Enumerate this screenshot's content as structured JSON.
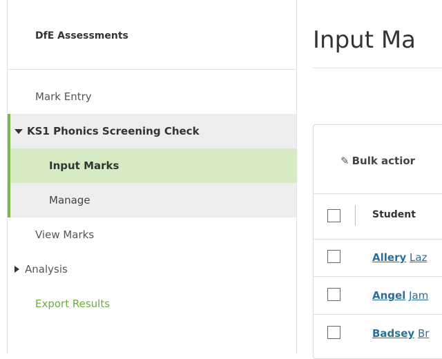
{
  "sidebar": {
    "title": "DfE Assessments",
    "items": {
      "mark_entry": "Mark Entry",
      "ks1": "KS1 Phonics Screening Check",
      "input_marks": "Input Marks",
      "manage": "Manage",
      "view_marks": "View Marks",
      "analysis": "Analysis",
      "export": "Export Results"
    }
  },
  "main": {
    "title": "Input Ma",
    "bulk_label": "Bulk actior",
    "table": {
      "student_header": "Student",
      "rows": [
        {
          "surname": "Allery",
          "forename": "Laz"
        },
        {
          "surname": "Angel",
          "forename": "Jam"
        },
        {
          "surname": "Badsey",
          "forename": "Br"
        }
      ]
    }
  },
  "colors": {
    "accent_green": "#7ab648",
    "active_bg": "#d6ebc4",
    "link": "#2a6f97",
    "export_green": "#6cae3a"
  },
  "icons": {
    "caret_down": "caret-down-icon",
    "caret_right": "caret-right-icon",
    "pencil": "pencil-icon"
  }
}
